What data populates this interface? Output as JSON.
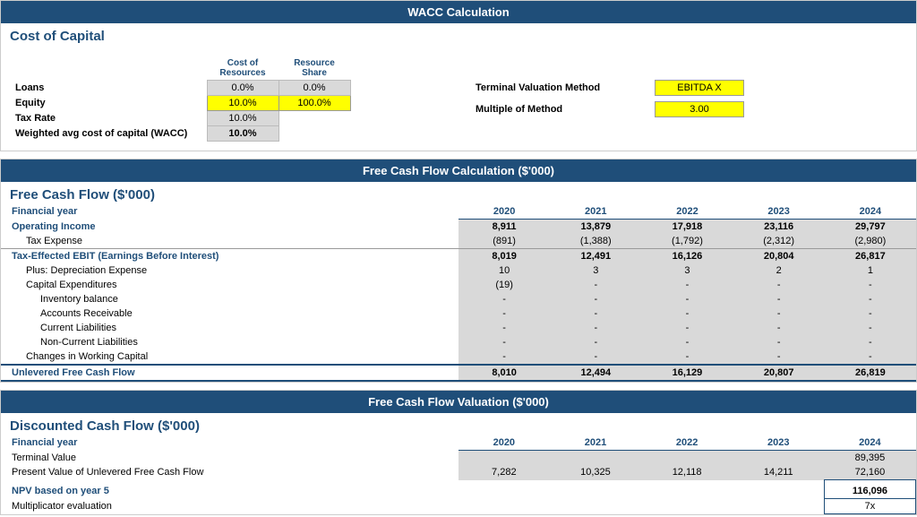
{
  "page_title": "WACC Calculation",
  "wacc": {
    "section_title": "Cost of Capital",
    "col_headers": [
      "Cost of Resources",
      "Resource Share"
    ],
    "rows": [
      {
        "label": "Loans",
        "cost": "0.0%",
        "share": "0.0%",
        "cost_style": "gray",
        "share_style": "gray"
      },
      {
        "label": "Equity",
        "cost": "10.0%",
        "share": "100.0%",
        "cost_style": "yellow",
        "share_style": "yellow"
      },
      {
        "label": "Tax Rate",
        "cost": "10.0%",
        "share": "",
        "cost_style": "gray",
        "share_style": ""
      },
      {
        "label": "Weighted avg cost of capital (WACC)",
        "cost": "10.0%",
        "share": "",
        "cost_style": "bold-gray",
        "share_style": ""
      }
    ],
    "terminal_label": "Terminal Valuation Method",
    "terminal_value": "EBITDA X",
    "multiple_label": "Multiple of Method",
    "multiple_value": "3.00"
  },
  "fcf": {
    "section_header": "Free Cash Flow Calculation ($'000)",
    "section_title": "Free Cash Flow ($'000)",
    "years": [
      "2020",
      "2021",
      "2022",
      "2023",
      "2024"
    ],
    "rows": [
      {
        "label": "Financial year",
        "indent": 0,
        "bold": true,
        "is_header": true,
        "vals": [
          "2020",
          "2021",
          "2022",
          "2023",
          "2024"
        ]
      },
      {
        "label": "Operating Income",
        "indent": 0,
        "bold": true,
        "vals": [
          "8,911",
          "13,879",
          "17,918",
          "23,116",
          "29,797"
        ]
      },
      {
        "label": "Tax Expense",
        "indent": 1,
        "bold": false,
        "vals": [
          "(891)",
          "(1,388)",
          "(1,792)",
          "(2,312)",
          "(2,980)"
        ]
      },
      {
        "label": "Tax-Effected EBIT (Earnings Before Interest)",
        "indent": 0,
        "bold": true,
        "vals": [
          "8,019",
          "12,491",
          "16,126",
          "20,804",
          "26,817"
        ],
        "border_top": true
      },
      {
        "label": "Plus: Depreciation Expense",
        "indent": 1,
        "bold": false,
        "vals": [
          "10",
          "3",
          "3",
          "2",
          "1"
        ]
      },
      {
        "label": "Capital Expenditures",
        "indent": 1,
        "bold": false,
        "vals": [
          "(19)",
          "-",
          "-",
          "-",
          "-"
        ]
      },
      {
        "label": "Inventory balance",
        "indent": 2,
        "bold": false,
        "vals": [
          "-",
          "-",
          "-",
          "-",
          "-"
        ]
      },
      {
        "label": "Accounts Receivable",
        "indent": 2,
        "bold": false,
        "vals": [
          "-",
          "-",
          "-",
          "-",
          "-"
        ]
      },
      {
        "label": "Current Liabilities",
        "indent": 2,
        "bold": false,
        "vals": [
          "-",
          "-",
          "-",
          "-",
          "-"
        ]
      },
      {
        "label": "Non-Current Liabilities",
        "indent": 2,
        "bold": false,
        "vals": [
          "-",
          "-",
          "-",
          "-",
          "-"
        ]
      },
      {
        "label": "Changes in Working Capital",
        "indent": 1,
        "bold": false,
        "vals": [
          "-",
          "-",
          "-",
          "-",
          "-"
        ]
      },
      {
        "label": "Unlevered Free Cash Flow",
        "indent": 0,
        "bold": true,
        "vals": [
          "8,010",
          "12,494",
          "16,129",
          "20,807",
          "26,819"
        ],
        "double_border": true
      }
    ]
  },
  "valuation": {
    "section_header": "Free Cash Flow Valuation ($'000)",
    "section_title": "Discounted Cash Flow ($'000)",
    "rows": [
      {
        "label": "Financial year",
        "indent": 0,
        "bold": true,
        "is_year_header": true,
        "vals": [
          "2020",
          "2021",
          "2022",
          "2023",
          "2024"
        ]
      },
      {
        "label": "Terminal Value",
        "indent": 0,
        "bold": false,
        "vals": [
          "",
          "",
          "",
          "",
          "89,395"
        ]
      },
      {
        "label": "Present Value of Unlevered Free Cash Flow",
        "indent": 0,
        "bold": false,
        "vals": [
          "7,282",
          "10,325",
          "12,118",
          "14,211",
          "72,160"
        ]
      },
      {
        "label": "NPV based on year 5",
        "indent": 0,
        "bold": true,
        "is_npv": true,
        "vals": [
          "",
          "",
          "",
          "",
          "116,096"
        ]
      },
      {
        "label": "Multiplicator evaluation",
        "indent": 0,
        "bold": false,
        "is_mult": true,
        "vals": [
          "",
          "",
          "",
          "",
          "7x"
        ]
      }
    ]
  }
}
